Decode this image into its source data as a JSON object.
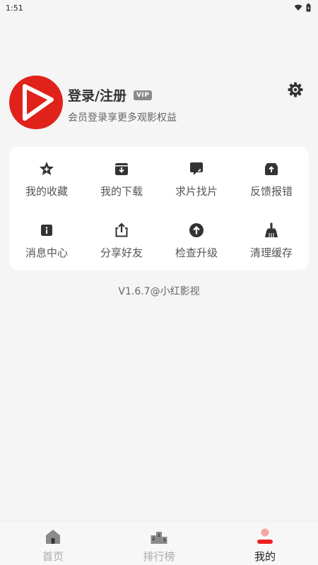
{
  "status_bar": {
    "time": "1:51"
  },
  "profile": {
    "title": "登录/注册",
    "vip_badge": "VIP",
    "subtitle": "会员登录享更多观影权益"
  },
  "menu": {
    "items": [
      {
        "label": "我的收藏",
        "icon": "star-icon"
      },
      {
        "label": "我的下载",
        "icon": "download-box-icon"
      },
      {
        "label": "求片找片",
        "icon": "chat-bubble-icon"
      },
      {
        "label": "反馈报错",
        "icon": "upload-box-icon"
      },
      {
        "label": "消息中心",
        "icon": "info-icon"
      },
      {
        "label": "分享好友",
        "icon": "share-icon"
      },
      {
        "label": "检查升级",
        "icon": "arrow-up-circle-icon"
      },
      {
        "label": "清理缓存",
        "icon": "broom-icon"
      }
    ]
  },
  "version_text": "V1.6.7@小红影视",
  "tabs": [
    {
      "label": "首页",
      "icon": "home-icon"
    },
    {
      "label": "排行榜",
      "icon": "podium-icon"
    },
    {
      "label": "我的",
      "icon": "user-icon"
    }
  ],
  "colors": {
    "brand_red": "#e0221a",
    "icon_gray": "#333333",
    "tab_active": "#ef1f1f"
  }
}
